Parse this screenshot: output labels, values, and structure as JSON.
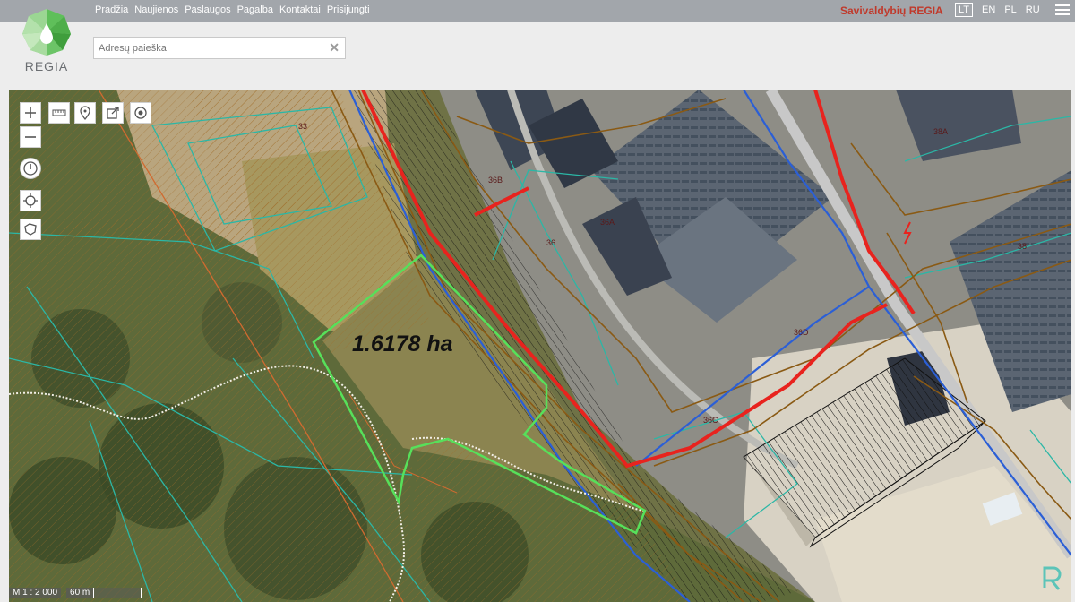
{
  "nav": {
    "items": [
      "Pradžia",
      "Naujienos",
      "Paslaugos",
      "Pagalba",
      "Kontaktai",
      "Prisijungti"
    ]
  },
  "brand": "Savivaldybių REGIA",
  "languages": [
    "LT",
    "EN",
    "PL",
    "RU"
  ],
  "active_language": "LT",
  "logo_text": "REGIA",
  "search": {
    "placeholder": "Adresų paieška"
  },
  "map": {
    "area_label": "1.6178 ha",
    "parcel_labels": [
      "33",
      "36B",
      "36A",
      "36",
      "38A",
      "38",
      "36D",
      "36C"
    ],
    "scale_ratio": "M 1 : 2 000",
    "scale_bar": "60 m"
  },
  "colors": {
    "topbar": "#a2a6ab",
    "brand": "#c0392b",
    "parcel_outline": "#2bb7a6",
    "highlight_parcel": "#57e05a",
    "utility_red": "#e8231e",
    "utility_blue": "#2b5fd6",
    "utility_brown": "#8a5a14"
  },
  "icons": {
    "zoom_in": "plus-icon",
    "zoom_out": "minus-icon",
    "measure": "ruler-icon",
    "marker": "location-pin-icon",
    "export": "export-icon",
    "layers": "target-icon",
    "compass": "compass-icon",
    "locate": "crosshair-icon",
    "map_region": "region-icon"
  }
}
